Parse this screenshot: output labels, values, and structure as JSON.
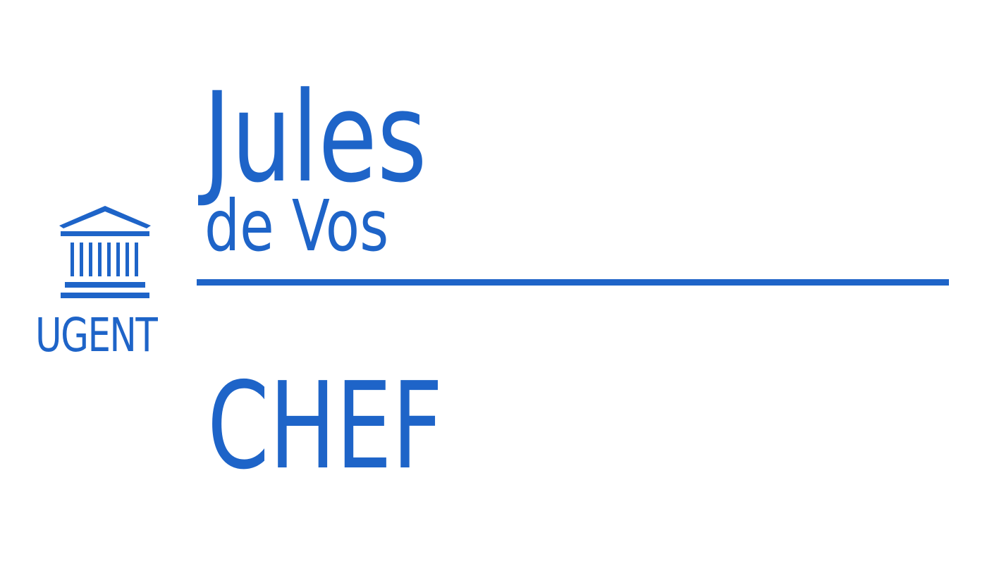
{
  "badge": {
    "first_name": "Jules",
    "last_name": "de Vos",
    "role": "CHEF"
  },
  "logo": {
    "icon": "building-columns-icon",
    "text": "UGENT"
  },
  "colors": {
    "brand": "#1e64c8",
    "background": "#ffffff"
  }
}
